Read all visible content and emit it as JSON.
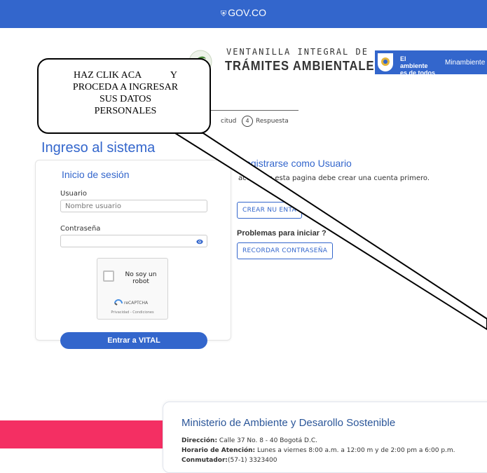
{
  "gov_bar": {
    "logo_text": "GOV.CO"
  },
  "header": {
    "title_line1": "VENTANILLA INTEGRAL DE",
    "title_line2": "TRÁMITES AMBIENTALES",
    "ministry_slogan": "El ambiente es de todos",
    "ministry_name": "Minambiente"
  },
  "stepper": {
    "step3_label": "citud",
    "step4_number": "4",
    "step4_label": "Respuesta"
  },
  "page_title": "Ingreso al sistema",
  "login": {
    "title": "Inicio de sesión",
    "username_label": "Usuario",
    "username_placeholder": "Nombre usuario",
    "password_label": "Contraseña",
    "password_value": "",
    "captcha_text": "No soy un robot",
    "captcha_brand": "reCAPTCHA",
    "captcha_links": "Privacidad - Condiciones",
    "submit_label": "Entrar a VITAL"
  },
  "register": {
    "title": "Registrarse como Usuario",
    "text": "acceder a esta pagina debe crear una cuenta primero.",
    "create_button": "CREAR NU          ENTA",
    "problems_title": "Problemas para iniciar        ?",
    "recover_button": "RECORDAR CONTRASEÑA"
  },
  "footer": {
    "title": "Ministerio de Ambiente y Desarollo Sostenible",
    "address_label": "Dirección:",
    "address_value": " Calle 37 No. 8 - 40 Bogotá D.C.",
    "hours_label": "Horario de Atención:",
    "hours_value": " Lunes a viernes 8:00 a.m. a 12:00 m y de 2:00 pm a 6:00 p.m.",
    "phone_label": "Conmutador:",
    "phone_value": "(57-1) 3323400"
  },
  "callout": {
    "text": "HAZ CLIK ACA            Y\nPROCEDA A INGRESAR\nSUS DATOS\nPERSONALES"
  },
  "colors": {
    "gov_blue": "#3366cc",
    "footer_pink": "#f42f63",
    "ministry_blue": "#3366cc"
  }
}
